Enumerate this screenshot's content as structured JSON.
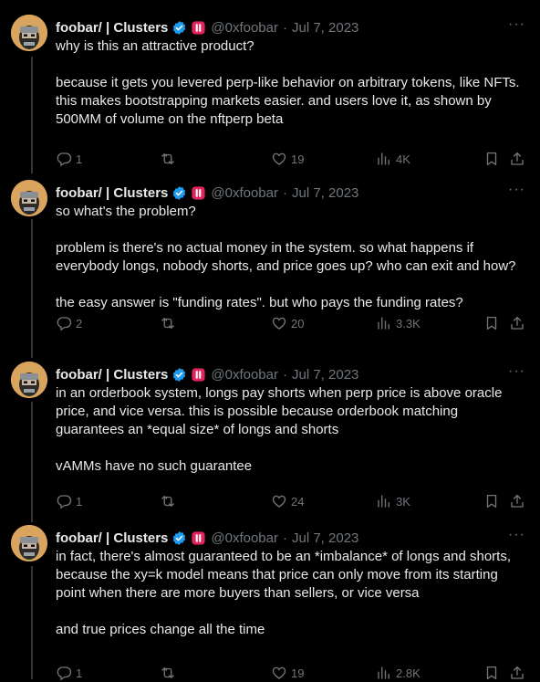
{
  "tweets": [
    {
      "name": "foobar/ | Clusters",
      "handle": "@0xfoobar",
      "sep": "·",
      "date": "Jul 7, 2023",
      "paragraphs": [
        "why is this an attractive product?",
        "because it gets you levered perp-like behavior on arbitrary tokens, like NFTs. this makes bootstrapping markets easier. and users love it, as shown by 500MM of volume on the nftperp beta"
      ],
      "replies": "1",
      "reposts": "",
      "likes": "19",
      "views": "4K"
    },
    {
      "name": "foobar/ | Clusters",
      "handle": "@0xfoobar",
      "sep": "·",
      "date": "Jul 7, 2023",
      "paragraphs": [
        "so what's the problem?",
        "problem is there's no actual money in the system. so what happens if everybody longs, nobody shorts, and price goes up? who can exit and how?",
        "the easy answer is \"funding rates\". but who pays the funding rates?"
      ],
      "replies": "2",
      "reposts": "",
      "likes": "20",
      "views": "3.3K"
    },
    {
      "name": "foobar/ | Clusters",
      "handle": "@0xfoobar",
      "sep": "·",
      "date": "Jul 7, 2023",
      "paragraphs": [
        "in an orderbook system, longs pay shorts when perp price is above oracle price, and vice versa. this is possible because orderbook matching guarantees an *equal size* of longs and shorts",
        "vAMMs have no such guarantee"
      ],
      "replies": "1",
      "reposts": "",
      "likes": "24",
      "views": "3K"
    },
    {
      "name": "foobar/ | Clusters",
      "handle": "@0xfoobar",
      "sep": "·",
      "date": "Jul 7, 2023",
      "paragraphs": [
        "in fact, there's almost guaranteed to be an *imbalance* of longs and shorts, because the xy=k model means that price can only move from its starting point when there are more buyers than sellers, or vice versa",
        "and true prices change all the time"
      ],
      "replies": "1",
      "reposts": "",
      "likes": "19",
      "views": "2.8K"
    }
  ],
  "colors": {
    "background": "#000000",
    "text": "#e7e9ea",
    "muted": "#71767b",
    "verified": "#1d9bf0",
    "affiliate": "#e0245e",
    "thread_line": "#333639"
  },
  "icons": [
    "avatar",
    "verified-badge-icon",
    "affiliate-badge-icon",
    "more-icon",
    "reply-icon",
    "repost-icon",
    "like-icon",
    "views-icon",
    "bookmark-icon",
    "share-icon"
  ]
}
